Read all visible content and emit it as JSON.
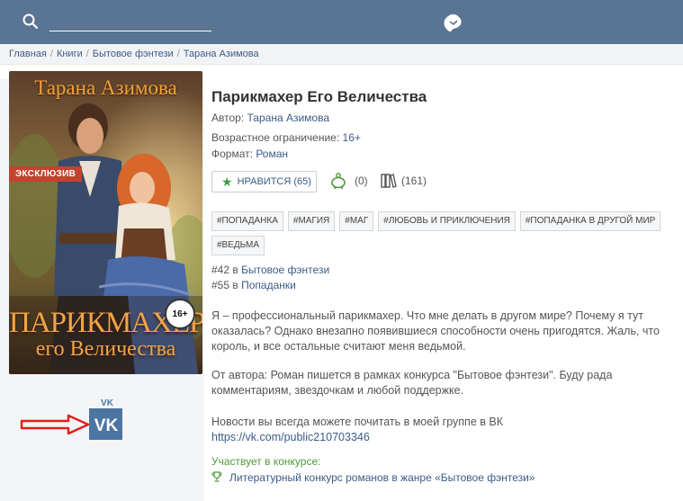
{
  "breadcrumb": [
    "Главная",
    "Книги",
    "Бытовое фэнтези",
    "Тарана Азимова"
  ],
  "book": {
    "title": "Парикмахер Его Величества",
    "author_label": "Автор:",
    "author": "Тарана Азимова",
    "age_label": "Возрастное ограничение:",
    "age": "16+",
    "format_label": "Формат:",
    "format": "Роман"
  },
  "cover": {
    "author_text": "Тарана Азимова",
    "badge": "ЭКСКЛЮЗИВ",
    "title_line1": "ПАРИКМАХЕР",
    "title_line2": "его Величества",
    "age_badge": "16+"
  },
  "stats": {
    "like_label": "НРАВИТСЯ (65)",
    "rewards": "(0)",
    "library": "(161)"
  },
  "tags": [
    "#ПОПАДАНКА",
    "#МАГИЯ",
    "#МАГ",
    "#ЛЮБОВЬ И ПРИКЛЮЧЕНИЯ",
    "#ПОПАДАНКА В ДРУГОЙ МИР",
    "#ВЕДЬМА"
  ],
  "ranks": [
    {
      "position": "#42",
      "word": "в",
      "genre": "Бытовое фэнтези"
    },
    {
      "position": "#55",
      "word": "в",
      "genre": "Попаданки"
    }
  ],
  "description": {
    "p1": "Я – профессиональный парикмахер. Что мне делать в другом мире? Почему я тут оказалась? Однако внезапно появившиеся способности очень пригодятся. Жаль, что король, и все остальные считают меня ведьмой.",
    "p2": "От автора: Роман пишется в рамках конкурса \"Бытовое фэнтези\". Буду рада комментариям, звездочкам и любой поддержке.",
    "p3": "Новости вы всегда можете почитать в моей группе в ВК",
    "vk_link": "https://vk.com/public210703346"
  },
  "contest": {
    "label": "Участвует в конкурсе:",
    "name": "Литературный конкурс романов в жанре «Бытовое фэнтези»"
  },
  "colors": {
    "header": "#5a7494",
    "link": "#3b5b86",
    "green": "#4e9a3a",
    "vk": "#4c75a3",
    "arrow": "#e0201b"
  }
}
